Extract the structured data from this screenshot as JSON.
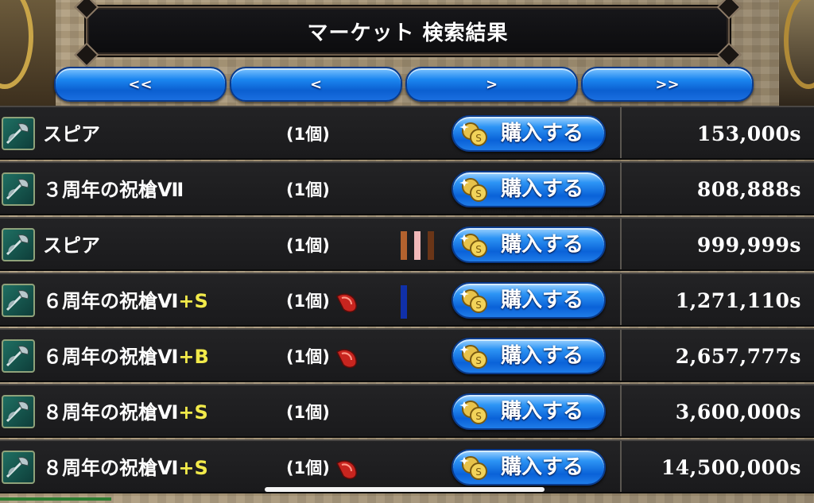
{
  "title": "マーケット 検索結果",
  "pager": [
    {
      "label": "<<"
    },
    {
      "label": "<"
    },
    {
      "label": ">"
    },
    {
      "label": ">>"
    }
  ],
  "buy_label": "購入する",
  "rows": [
    {
      "name": "スピア",
      "suffix": "",
      "qty": "(1個)",
      "gem": false,
      "markers": [],
      "price": "153,000s"
    },
    {
      "name": "３周年の祝槍Ⅶ",
      "suffix": "",
      "qty": "(1個)",
      "gem": false,
      "markers": [],
      "price": "808,888s"
    },
    {
      "name": "スピア",
      "suffix": "",
      "qty": "(1個)",
      "gem": false,
      "markers": [
        "#b3622e",
        "#f1b8b8",
        "#6a3517"
      ],
      "price": "999,999s"
    },
    {
      "name": "６周年の祝槍Ⅵ",
      "suffix": "+S",
      "qty": "(1個)",
      "gem": true,
      "markers": [
        "#1030a8"
      ],
      "price": "1,271,110s"
    },
    {
      "name": "６周年の祝槍Ⅵ",
      "suffix": "+B",
      "qty": "(1個)",
      "gem": true,
      "markers": [],
      "price": "2,657,777s"
    },
    {
      "name": "８周年の祝槍Ⅵ",
      "suffix": "+S",
      "qty": "(1個)",
      "gem": false,
      "markers": [],
      "price": "3,600,000s"
    },
    {
      "name": "８周年の祝槍Ⅵ",
      "suffix": "+S",
      "qty": "(1個)",
      "gem": true,
      "markers": [],
      "price": "14,500,000s"
    }
  ],
  "colors": {
    "accent_blue": "#1b86f0",
    "suffix_yellow": "#f2ea4a",
    "row_bg": "#1e1e20"
  },
  "icons": {
    "item": "spear-axe-icon",
    "coin": "coins-icon",
    "gem": "red-gem-icon"
  }
}
